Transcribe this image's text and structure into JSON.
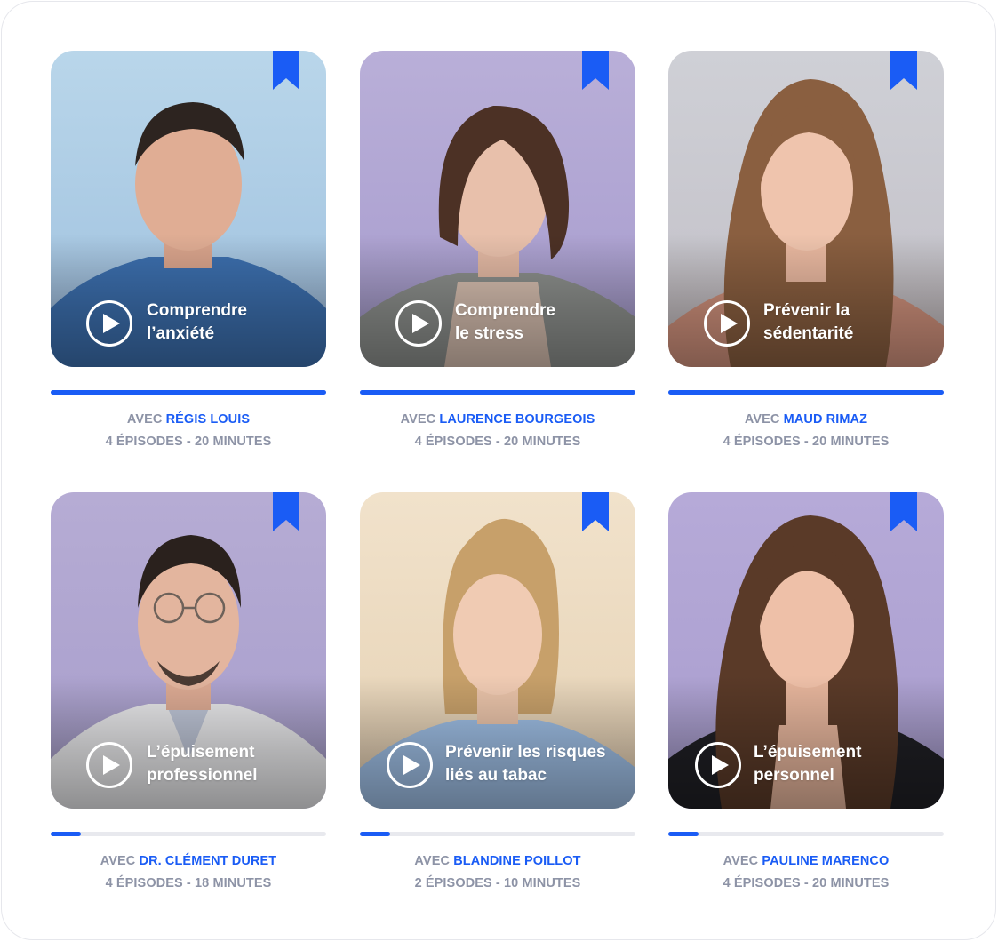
{
  "colors": {
    "accent": "#1a5cf5",
    "muted_text": "#8d93a6",
    "track": "#e8e9ee"
  },
  "courses": [
    {
      "title": "Comprendre\nl’anxiété",
      "avec": "AVEC",
      "speaker": "RÉGIS LOUIS",
      "details": "4 ÉPISODES - 20 MINUTES",
      "progress": 1.0,
      "bookmark_icon": "bookmark-icon",
      "play_icon": "play-circle-icon"
    },
    {
      "title": "Comprendre\nle stress",
      "avec": "AVEC",
      "speaker": "LAURENCE BOURGEOIS",
      "details": "4 ÉPISODES - 20 MINUTES",
      "progress": 1.0,
      "bookmark_icon": "bookmark-icon",
      "play_icon": "play-circle-icon"
    },
    {
      "title": "Prévenir la\nsédentarité",
      "avec": "AVEC",
      "speaker": "MAUD RIMAZ",
      "details": "4 ÉPISODES - 20 MINUTES",
      "progress": 1.0,
      "bookmark_icon": "bookmark-icon",
      "play_icon": "play-circle-icon"
    },
    {
      "title": "L’épuisement\nprofessionnel",
      "avec": "AVEC",
      "speaker": "DR. CLÉMENT DURET",
      "details": "4 ÉPISODES - 18 MINUTES",
      "progress": 0.11,
      "bookmark_icon": "bookmark-icon",
      "play_icon": "play-circle-icon"
    },
    {
      "title": "Prévenir les risques\nliés au tabac",
      "avec": "AVEC",
      "speaker": "BLANDINE POILLOT",
      "details": "2 ÉPISODES - 10 MINUTES",
      "progress": 0.11,
      "bookmark_icon": "bookmark-icon",
      "play_icon": "play-circle-icon"
    },
    {
      "title": "L’épuisement\npersonnel",
      "avec": "AVEC",
      "speaker": "PAULINE MARENCO",
      "details": "4 ÉPISODES - 20 MINUTES",
      "progress": 0.11,
      "bookmark_icon": "bookmark-icon",
      "play_icon": "play-circle-icon"
    }
  ]
}
